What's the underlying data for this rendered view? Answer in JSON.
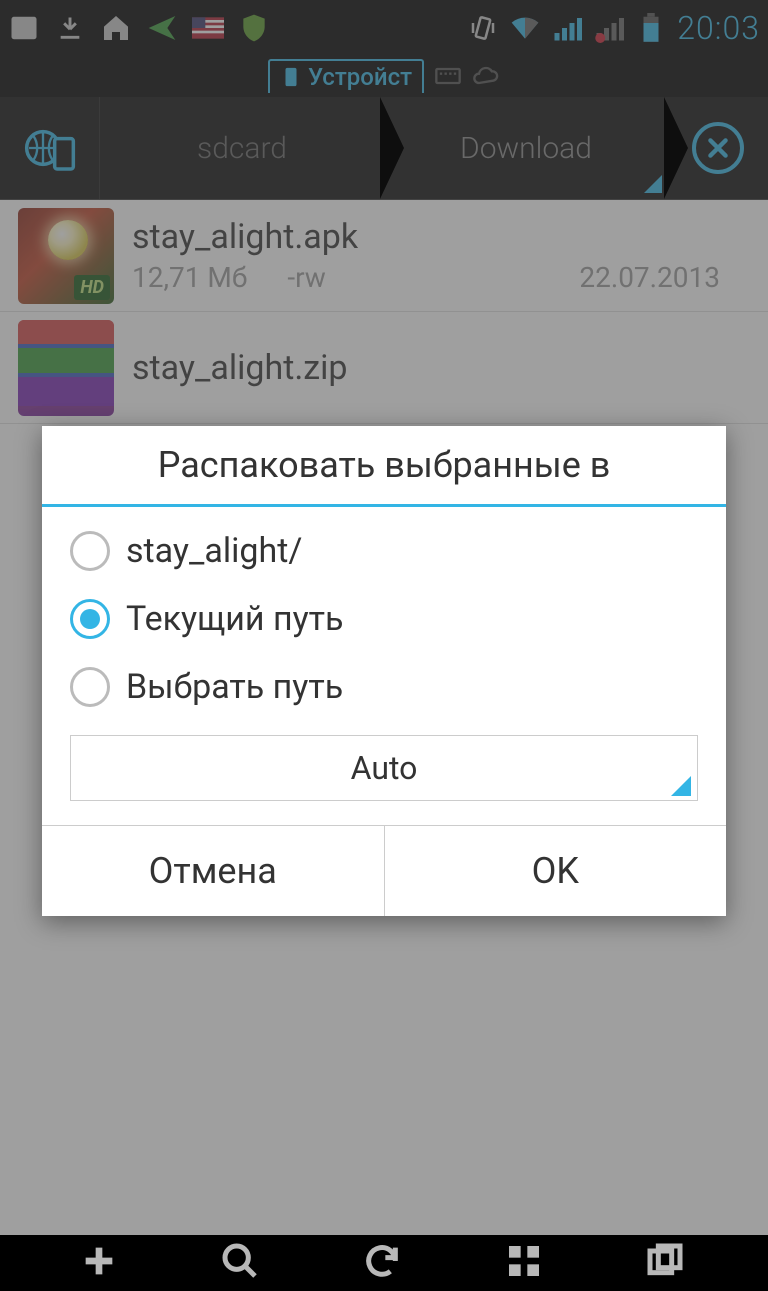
{
  "status": {
    "time": "20:03"
  },
  "tabs": {
    "active_label": "Устройст",
    "icon_name": "device-icon"
  },
  "breadcrumb": {
    "items": [
      "sdcard",
      "Download"
    ]
  },
  "files": [
    {
      "name": "stay_alight.apk",
      "size": "12,71 Мб",
      "perms": "-rw",
      "date": "22.07.2013",
      "icon_type": "apk"
    },
    {
      "name": "stay_alight.zip",
      "size": "",
      "perms": "",
      "date": "",
      "icon_type": "zip"
    }
  ],
  "dialog": {
    "title": "Распаковать выбранные в",
    "options": [
      {
        "label": "stay_alight/",
        "checked": false
      },
      {
        "label": "Текущий путь",
        "checked": true
      },
      {
        "label": "Выбрать путь",
        "checked": false
      }
    ],
    "select_value": "Auto",
    "cancel_label": "Отмена",
    "ok_label": "OK"
  },
  "colors": {
    "accent": "#33b5e5"
  }
}
